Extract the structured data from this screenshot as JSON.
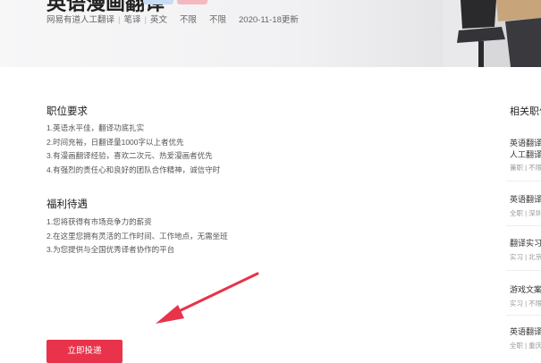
{
  "hero": {
    "title": "英语漫画翻译",
    "meta": {
      "company": "网易有道人工翻译",
      "type": "笔译",
      "language": "英文",
      "req1": "不限",
      "req2": "不限",
      "updated": "2020-11-18更新"
    },
    "tag_colors": [
      "#c9dcf5",
      "#f4b8bf"
    ]
  },
  "requirements": {
    "title": "职位要求",
    "items": [
      "1.英语水平佳，翻译功底扎实",
      "2.时间充裕，日翻译量1000字以上者优先",
      "3.有漫画翻译经验，喜欢二次元、热爱漫画者优先",
      "4.有强烈的责任心和良好的团队合作精神，诚信守时"
    ]
  },
  "benefits": {
    "title": "福利待遇",
    "items": [
      "1.您将获得有市场竞争力的薪资",
      "2.在这里您拥有灵活的工作时间、工作地点，无需坐班",
      "3.为您提供与全国优秀译者协作的平台"
    ]
  },
  "apply_label": "立即投递",
  "accent_color": "#e8334b",
  "sidebar": {
    "title": "相关职位",
    "items": [
      {
        "title": "英语翻译",
        "title2": "人工翻译",
        "sub": "兼职 | 不限"
      },
      {
        "title": "英语翻译",
        "sub": "全职 | 深圳"
      },
      {
        "title": "翻译实习",
        "sub": "实习 | 北京"
      },
      {
        "title": "游戏文案",
        "sub": "实习 | 不限"
      },
      {
        "title": "英语翻译",
        "sub": "全职 | 重庆"
      }
    ]
  }
}
